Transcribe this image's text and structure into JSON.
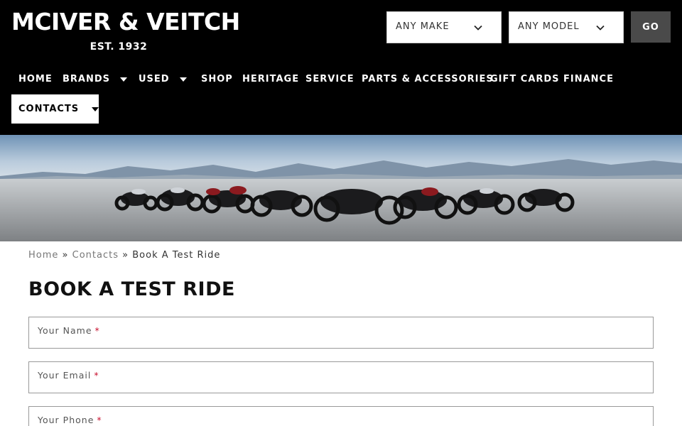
{
  "brand": {
    "name": "MCIVER & VEITCH",
    "established": "EST. 1932"
  },
  "search": {
    "make": "ANY MAKE",
    "model": "ANY MODEL",
    "go_label": "GO"
  },
  "nav": {
    "items": [
      {
        "label": "HOME"
      },
      {
        "label": "BRANDS"
      },
      {
        "label": "USED"
      },
      {
        "label": "SHOP"
      },
      {
        "label": "HERITAGE"
      },
      {
        "label": "SERVICE"
      },
      {
        "label": "PARTS & ACCESSORIES"
      },
      {
        "label": "GIFT CARDS"
      },
      {
        "label": "FINANCE"
      }
    ],
    "contacts_label": "CONTACTS"
  },
  "breadcrumb": {
    "home": "Home",
    "sep1": "»",
    "contacts": "Contacts",
    "sep2": "»",
    "current": "Book A Test Ride"
  },
  "page": {
    "title": "BOOK A TEST RIDE"
  },
  "form": {
    "name_label": "Your Name",
    "email_label": "Your Email",
    "phone_label": "Your Phone",
    "required_mark": "*"
  },
  "colors": {
    "header_bg": "#000000",
    "go_bg": "#4a4a4a",
    "required": "#c8102e"
  }
}
